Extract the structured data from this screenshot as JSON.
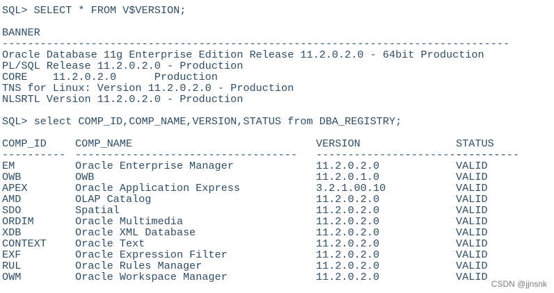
{
  "terminal": {
    "prompt1": "SQL> SELECT * FROM V$VERSION;",
    "banner": {
      "header": "BANNER",
      "separator": "--------------------------------------------------------------------------------",
      "lines": [
        "Oracle Database 11g Enterprise Edition Release 11.2.0.2.0 - 64bit Production",
        "PL/SQL Release 11.2.0.2.0 - Production",
        "CORE\t11.2.0.2.0\tProduction",
        "TNS for Linux: Version 11.2.0.2.0 - Production",
        "NLSRTL Version 11.2.0.2.0 - Production"
      ]
    },
    "prompt2": "SQL> select COMP_ID,COMP_NAME,VERSION,STATUS from DBA_REGISTRY;",
    "registry": {
      "headers": [
        "COMP_ID",
        "COMP_NAME",
        "VERSION",
        "STATUS"
      ],
      "separators": [
        "----------",
        "-----------------------------------",
        "------------------------------",
        "----------"
      ],
      "rows": [
        [
          "EM",
          "Oracle Enterprise Manager",
          "11.2.0.2.0",
          "VALID"
        ],
        [
          "OWB",
          "OWB",
          "11.2.0.1.0",
          "VALID"
        ],
        [
          "APEX",
          "Oracle Application Express",
          "3.2.1.00.10",
          "VALID"
        ],
        [
          "AMD",
          "OLAP Catalog",
          "11.2.0.2.0",
          "VALID"
        ],
        [
          "SDO",
          "Spatial",
          "11.2.0.2.0",
          "VALID"
        ],
        [
          "ORDIM",
          "Oracle Multimedia",
          "11.2.0.2.0",
          "VALID"
        ],
        [
          "XDB",
          "Oracle XML Database",
          "11.2.0.2.0",
          "VALID"
        ],
        [
          "CONTEXT",
          "Oracle Text",
          "11.2.0.2.0",
          "VALID"
        ],
        [
          "EXF",
          "Oracle Expression Filter",
          "11.2.0.2.0",
          "VALID"
        ],
        [
          "RUL",
          "Oracle Rules Manager",
          "11.2.0.2.0",
          "VALID"
        ],
        [
          "OWM",
          "Oracle Workspace Manager",
          "11.2.0.2.0",
          "VALID"
        ]
      ]
    }
  },
  "watermark": "CSDN @jjnsnk",
  "colors": {
    "text": "#2f4d63",
    "background": "#ffffff",
    "watermark": "#7c7c7c"
  }
}
